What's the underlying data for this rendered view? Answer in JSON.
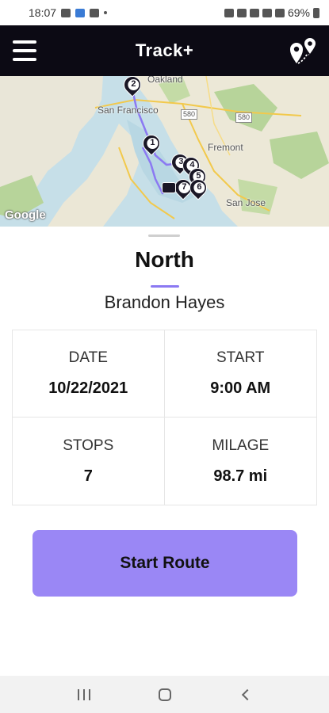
{
  "status_bar": {
    "time": "18:07",
    "battery": "69%"
  },
  "app_bar": {
    "title": "Track+",
    "menu_icon": "hamburger-menu-icon",
    "route_icon": "route-pins-icon"
  },
  "map": {
    "labels": {
      "oakland": "Oakland",
      "san_francisco": "San Francisco",
      "fremont": "Fremont",
      "san_jose": "San Jose",
      "highway_1": "580",
      "highway_2": "580"
    },
    "attribution": "Google",
    "stops": [
      "1",
      "2",
      "3",
      "4",
      "5",
      "6",
      "7"
    ]
  },
  "route": {
    "name": "North",
    "driver": "Brandon Hayes"
  },
  "stats": {
    "date_label": "DATE",
    "date_value": "10/22/2021",
    "start_label": "START",
    "start_value": "9:00 AM",
    "stops_label": "STOPS",
    "stops_value": "7",
    "milage_label": "MILAGE",
    "milage_value": "98.7 mi"
  },
  "actions": {
    "start_route_label": "Start Route"
  },
  "colors": {
    "app_bar_bg": "#0c0a14",
    "accent": "#9a87f5",
    "route_line": "#8b79f2"
  }
}
